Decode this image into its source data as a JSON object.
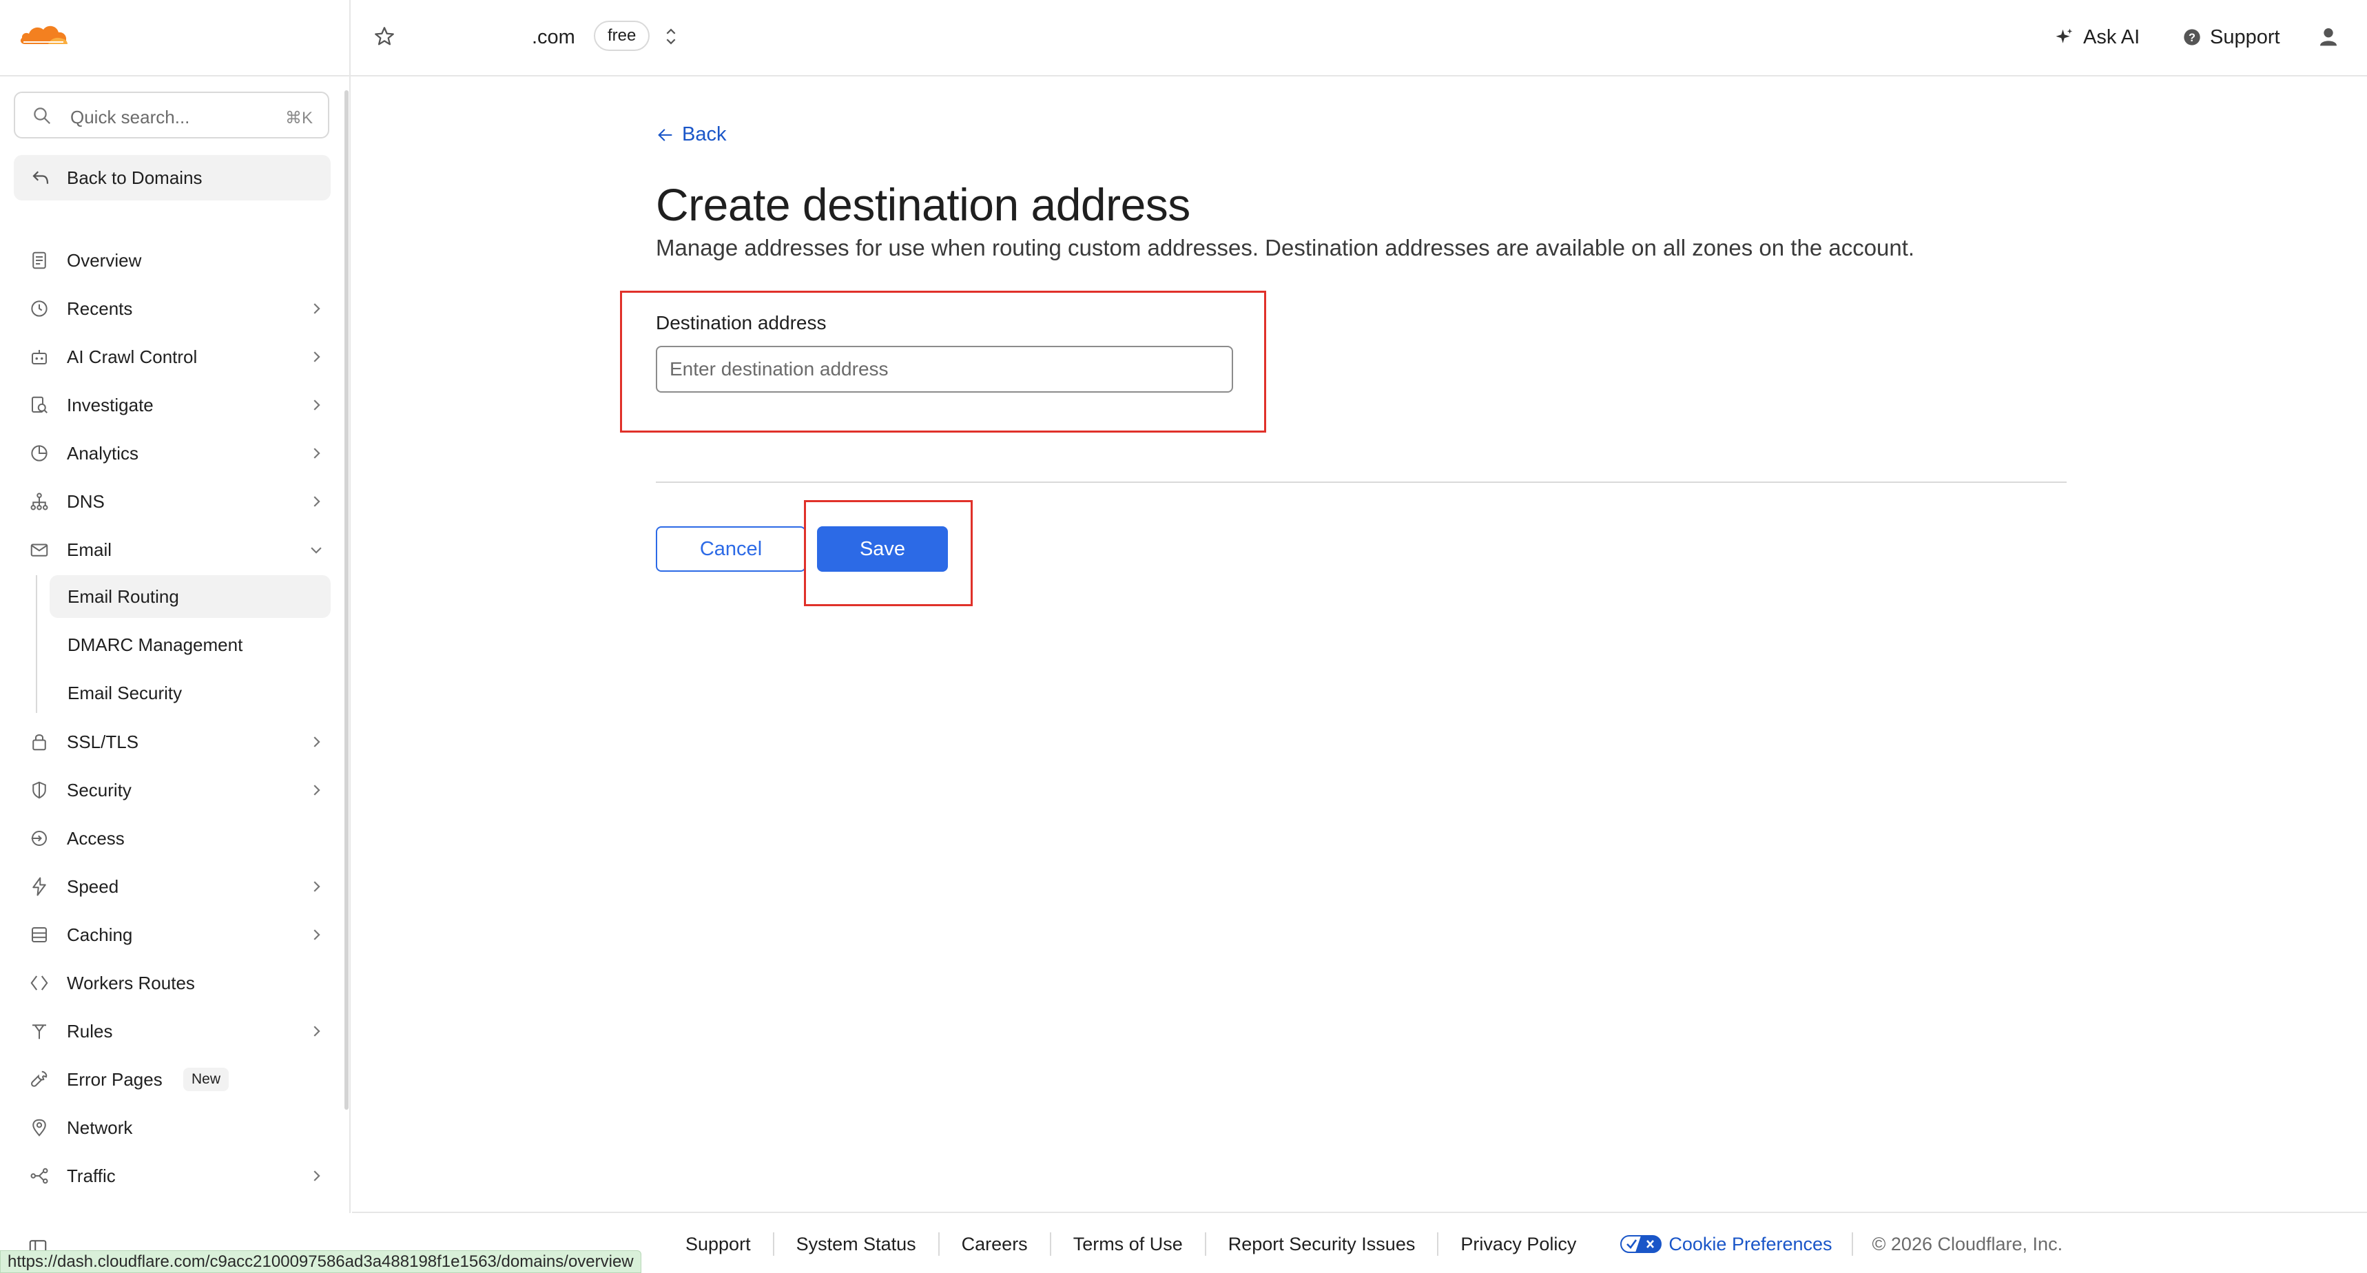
{
  "topbar": {
    "domain_suffix": ".com",
    "plan_badge": "free",
    "ask_ai_label": "Ask AI",
    "support_label": "Support"
  },
  "sidebar": {
    "search_placeholder": "Quick search...",
    "search_shortcut": "⌘K",
    "back_label": "Back to Domains",
    "items": [
      {
        "label": "Overview",
        "icon": "document-icon"
      },
      {
        "label": "Recents",
        "icon": "clock-icon"
      },
      {
        "label": "AI Crawl Control",
        "icon": "robot-icon"
      },
      {
        "label": "Investigate",
        "icon": "investigate-icon"
      },
      {
        "label": "Analytics",
        "icon": "pie-chart-icon"
      },
      {
        "label": "DNS",
        "icon": "network-icon"
      },
      {
        "label": "Email",
        "icon": "envelope-icon"
      },
      {
        "label": "SSL/TLS",
        "icon": "lock-icon"
      },
      {
        "label": "Security",
        "icon": "shield-icon"
      },
      {
        "label": "Access",
        "icon": "access-icon"
      },
      {
        "label": "Speed",
        "icon": "bolt-icon"
      },
      {
        "label": "Caching",
        "icon": "database-icon"
      },
      {
        "label": "Workers Routes",
        "icon": "workers-icon"
      },
      {
        "label": "Rules",
        "icon": "rules-icon"
      },
      {
        "label": "Error Pages",
        "icon": "wrench-icon",
        "badge": "New"
      },
      {
        "label": "Network",
        "icon": "location-pin-icon"
      },
      {
        "label": "Traffic",
        "icon": "traffic-icon"
      }
    ],
    "email_sub": [
      "Email Routing",
      "DMARC Management",
      "Email Security"
    ]
  },
  "main": {
    "back_label": "Back",
    "title": "Create destination address",
    "description": "Manage addresses for use when routing custom addresses. Destination addresses are available on all zones on the account.",
    "field_label": "Destination address",
    "field_placeholder": "Enter destination address",
    "cancel_label": "Cancel",
    "save_label": "Save",
    "accent_color": "#2c6ae6",
    "highlight_color": "#e0312a"
  },
  "footer": {
    "links": [
      "Support",
      "System Status",
      "Careers",
      "Terms of Use",
      "Report Security Issues",
      "Privacy Policy"
    ],
    "cookie_label": "Cookie Preferences",
    "copyright": "© 2026 Cloudflare, Inc."
  },
  "statusbar": {
    "url": "https://dash.cloudflare.com/c9acc2100097586ad3a488198f1e1563/domains/overview"
  }
}
